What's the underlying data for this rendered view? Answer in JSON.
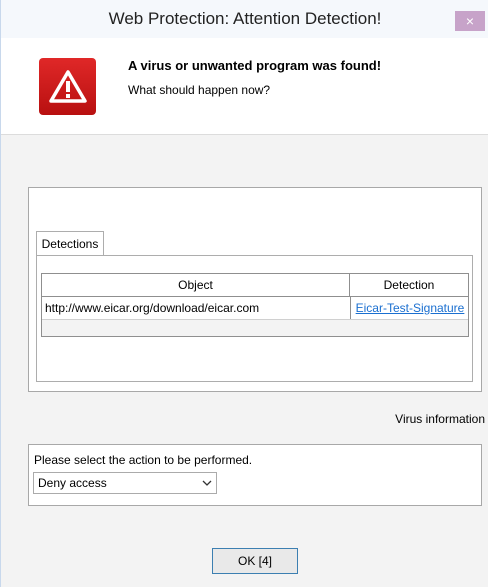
{
  "window": {
    "title": "Web Protection: Attention Detection!",
    "close_glyph": "×"
  },
  "header": {
    "icon": "warning-triangle-icon",
    "headline": "A virus or unwanted program was found!",
    "subline": "What should happen now?"
  },
  "detections": {
    "tab_label": "Detections",
    "columns": [
      "Object",
      "Detection"
    ],
    "rows": [
      {
        "object": "http://www.eicar.org/download/eicar.com",
        "detection": "Eicar-Test-Signature"
      }
    ]
  },
  "virus_info_label": "Virus information",
  "action": {
    "prompt": "Please select the action to be performed.",
    "selected": "Deny access"
  },
  "ok_button": "OK [4]",
  "colors": {
    "alert_red": "#d01c1c",
    "link_blue": "#1a6fd0",
    "close_button": "#c7a3c9"
  }
}
